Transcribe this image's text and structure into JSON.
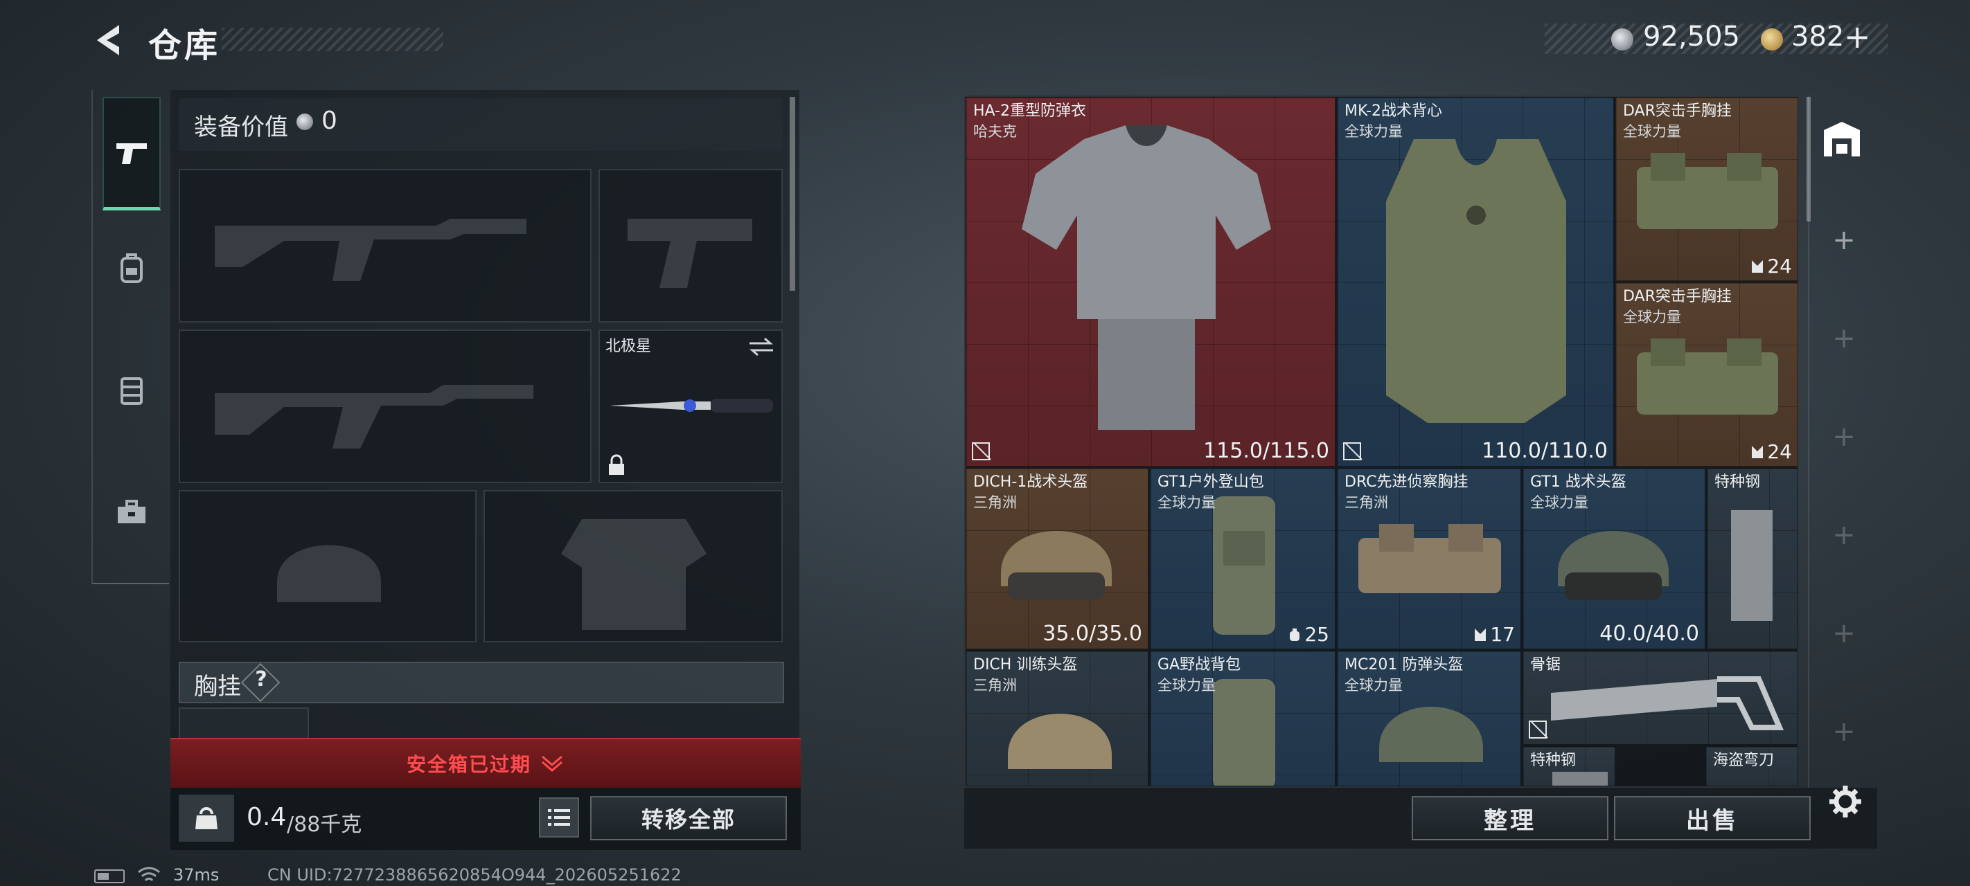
{
  "header": {
    "title": "仓库",
    "currency": {
      "silver_amount": "92,505",
      "gold_amount": "382",
      "add_label": "+"
    }
  },
  "left_nav": {
    "items": [
      {
        "name": "weapons",
        "icon": "pistol-icon",
        "active": true
      },
      {
        "name": "backpack",
        "icon": "backpack-icon",
        "active": false
      },
      {
        "name": "vest",
        "icon": "vest-icon",
        "active": false
      },
      {
        "name": "toolbox",
        "icon": "toolbox-icon",
        "active": false
      }
    ]
  },
  "equipment": {
    "value_label": "装备价值",
    "value": "0",
    "melee_slot": {
      "name": "北极星",
      "locked": true
    },
    "chest_rig_label": "胸挂",
    "chest_rig_help": "?",
    "safebox_status": "安全箱已过期",
    "weight_current": "0.4",
    "weight_max": "/88千克",
    "weight_icon_text": "KG",
    "transfer_all_label": "转移全部"
  },
  "warehouse": {
    "items": [
      {
        "name": "HA-2重型防弹衣",
        "brand": "哈夫克",
        "durability": "115.0/115.0",
        "rarity": "red"
      },
      {
        "name": "MK-2战术背心",
        "brand": "全球力量",
        "durability": "110.0/110.0",
        "rarity": "blue"
      },
      {
        "name": "DAR突击手胸挂",
        "brand": "全球力量",
        "stack": "24",
        "rarity": "brown"
      },
      {
        "name": "DAR突击手胸挂",
        "brand": "全球力量",
        "stack": "24",
        "rarity": "brown"
      },
      {
        "name": "DICH-1战术头盔",
        "brand": "三角洲",
        "durability": "35.0/35.0",
        "rarity": "brown"
      },
      {
        "name": "GT1户外登山包",
        "brand": "全球力量",
        "stack": "25",
        "rarity": "blue"
      },
      {
        "name": "DRC先进侦察胸挂",
        "brand": "三角洲",
        "stack": "17",
        "rarity": "blue"
      },
      {
        "name": "GT1 战术头盔",
        "brand": "全球力量",
        "durability": "40.0/40.0",
        "rarity": "blue"
      },
      {
        "name": "特种钢",
        "brand": "",
        "rarity": "slate"
      },
      {
        "name": "DICH 训练头盔",
        "brand": "三角洲",
        "rarity": "slate"
      },
      {
        "name": "GA野战背包",
        "brand": "全球力量",
        "rarity": "blue"
      },
      {
        "name": "MC201 防弹头盔",
        "brand": "全球力量",
        "rarity": "blue"
      },
      {
        "name": "骨锯",
        "brand": "",
        "rarity": "slate"
      },
      {
        "name": "特种钢",
        "brand": "",
        "rarity": "slate"
      },
      {
        "name": "海盗弯刀",
        "brand": "",
        "rarity": "slate"
      }
    ]
  },
  "actions": {
    "sort_label": "整理",
    "sell_label": "出售"
  },
  "status_bar": {
    "ping": "37ms",
    "uid": "CN UID:7277238865620854O944_202605251622"
  },
  "colors": {
    "accent": "#6fd8b2",
    "rarity_red": "#6a2a30",
    "rarity_blue": "#263d52",
    "rarity_brown": "#56402f",
    "warning": "#ff4d4f"
  }
}
